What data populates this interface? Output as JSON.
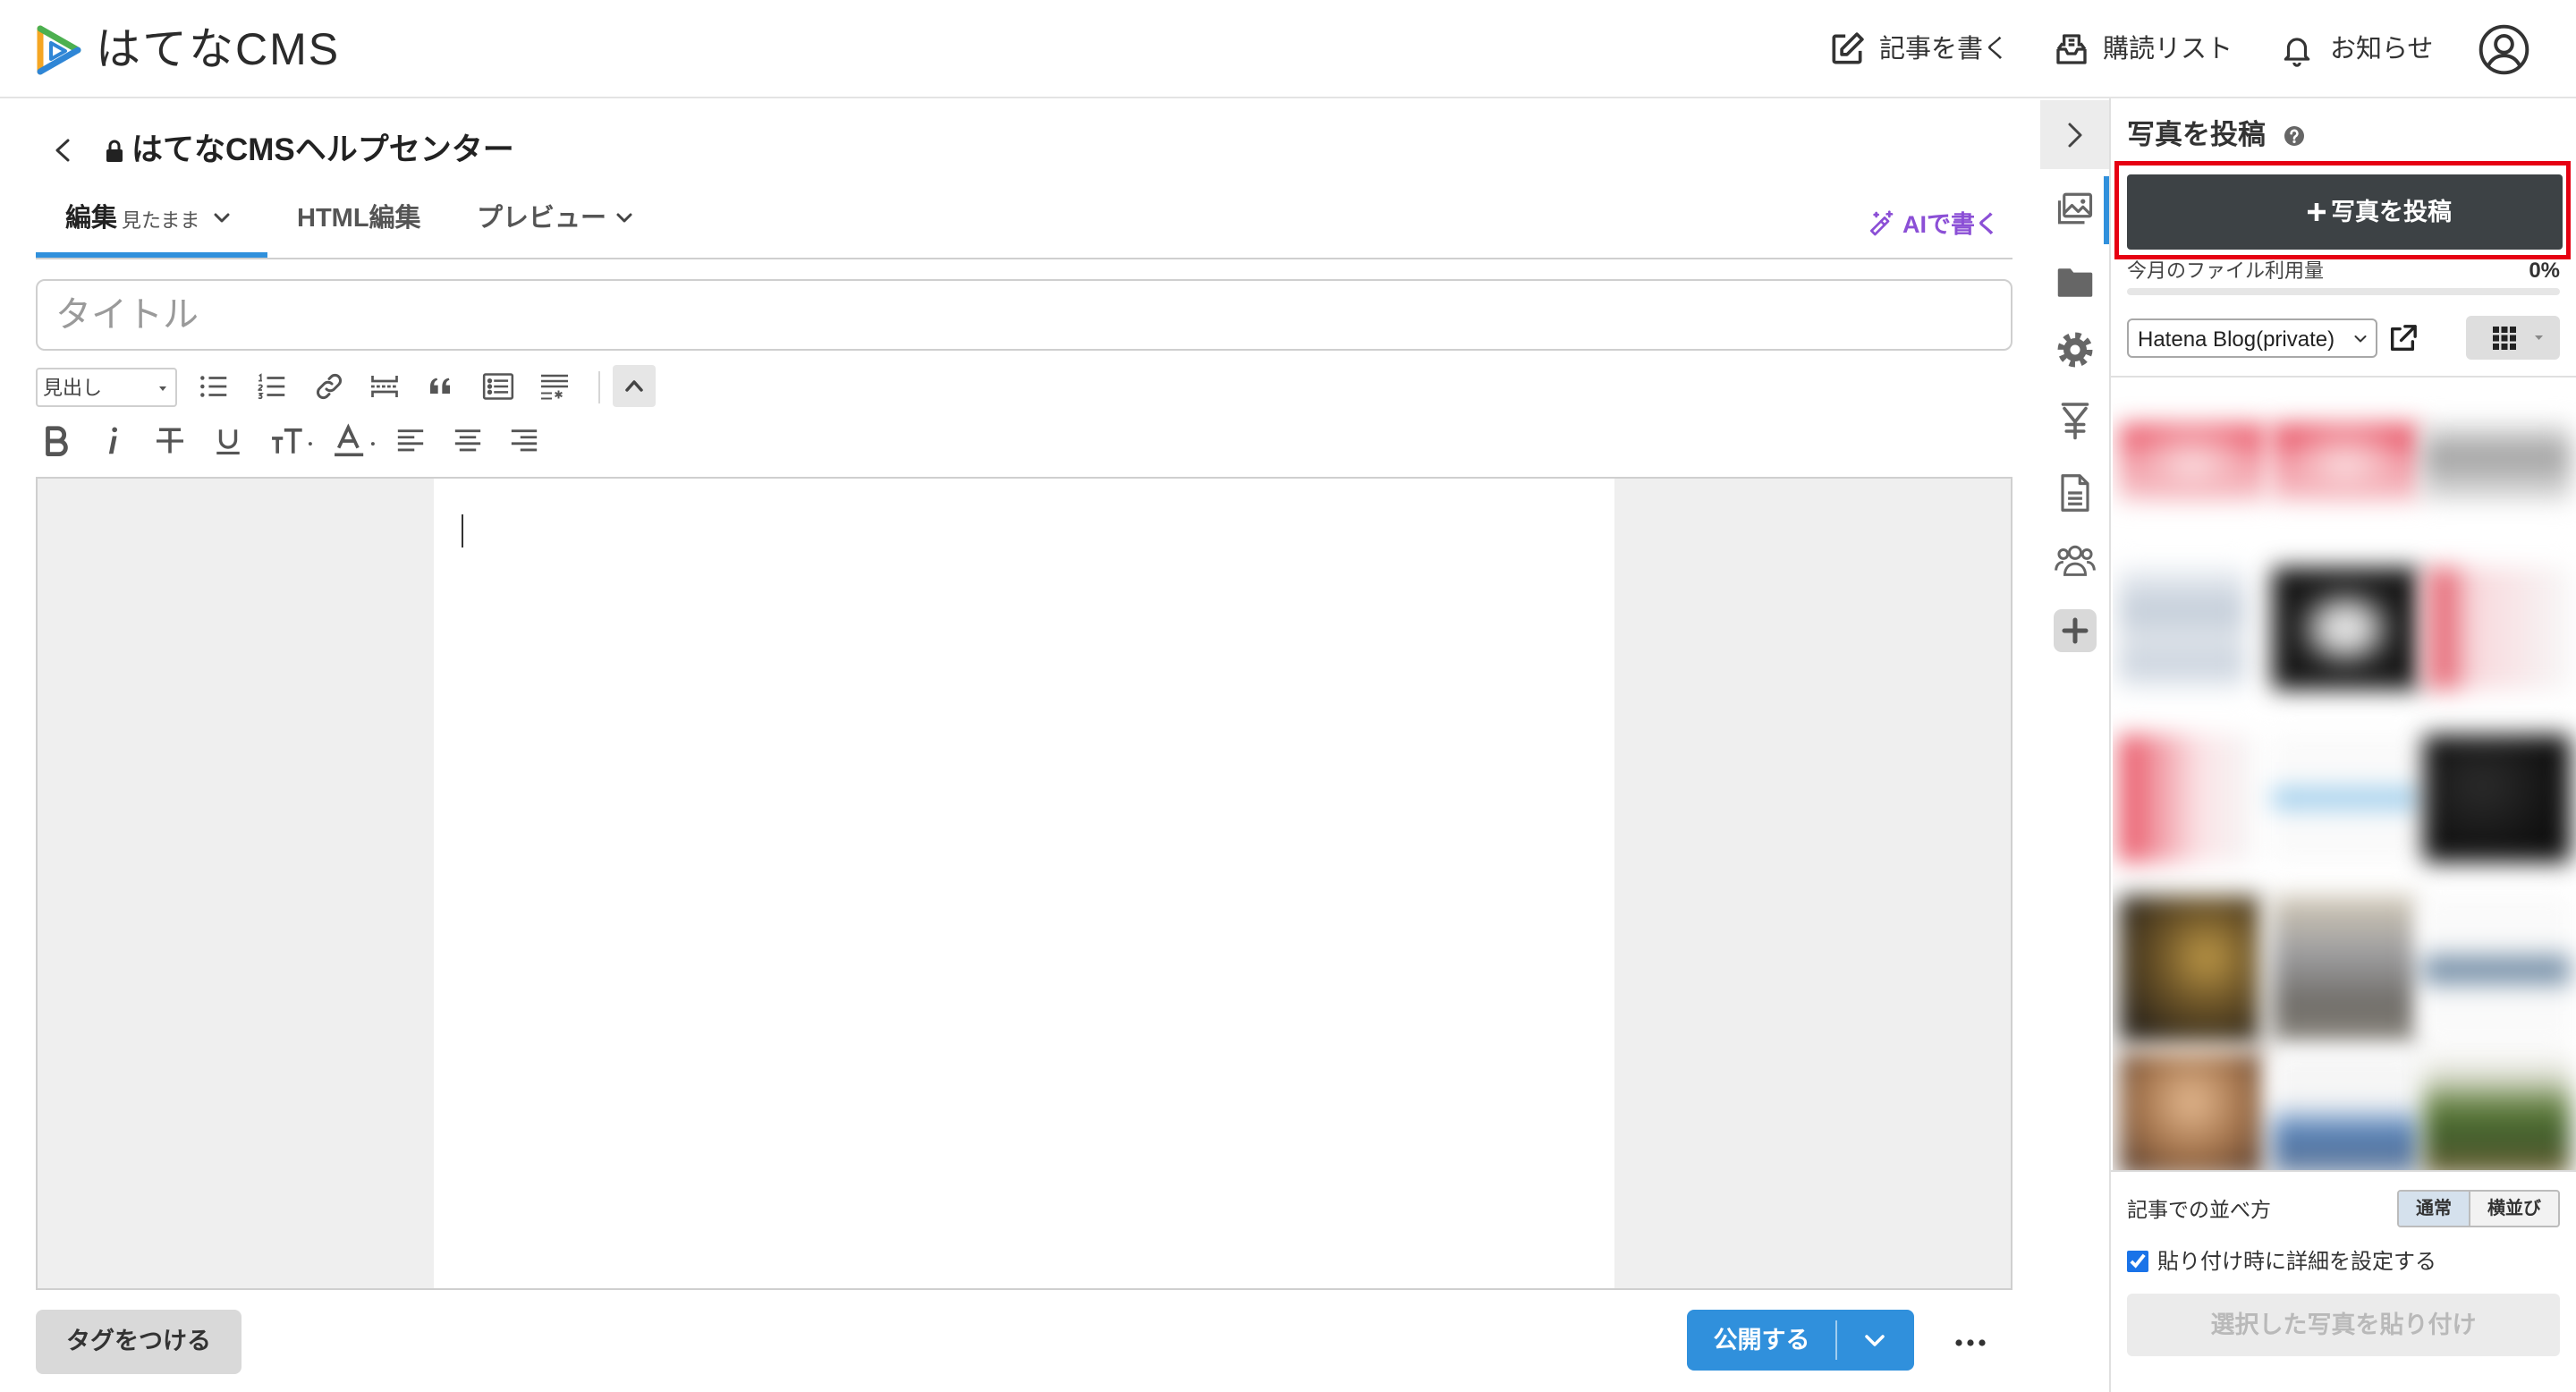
{
  "app": {
    "logo_text": "はてなCMS"
  },
  "header": {
    "write_label": "記事を書く",
    "reading_list_label": "購読リスト",
    "notifications_label": "お知らせ"
  },
  "editor": {
    "blog_title": "はてなCMSヘルプセンター",
    "tabs": [
      {
        "label": "編集",
        "sub": "見たまま",
        "active": true
      },
      {
        "label": "HTML編集",
        "active": false
      },
      {
        "label": "プレビュー",
        "active": false
      }
    ],
    "ai_label": "AIで書く",
    "title_placeholder": "タイトル",
    "heading_select": "見出し",
    "tag_button": "タグをつける",
    "publish_button": "公開する"
  },
  "photo_panel": {
    "title": "写真を投稿",
    "upload_button": "写真を投稿",
    "usage_label": "今月のファイル利用量",
    "usage_percent_text": "0%",
    "usage_value": 0,
    "album_select": "Hatena Blog(private)",
    "layout_label": "記事での並べ方",
    "layout_options": [
      {
        "label": "通常",
        "active": true
      },
      {
        "label": "横並び",
        "active": false
      }
    ],
    "detail_checkbox_label": "貼り付け時に詳細を設定する",
    "detail_checkbox_checked": true,
    "paste_button": "選択した写真を貼り付け"
  },
  "icons": {
    "header": [
      "write-icon",
      "reading-list-icon",
      "bell-icon",
      "avatar-icon"
    ],
    "rail": [
      "chevron-right-icon",
      "photo-icon",
      "folder-icon",
      "gear-icon",
      "yen-icon",
      "document-icon",
      "people-icon",
      "plus-square-icon"
    ]
  },
  "colors": {
    "accent": "#3090dc",
    "ai_purple": "#8b4fd6",
    "highlight_red": "#e60012",
    "dark_button": "#3d4245"
  }
}
